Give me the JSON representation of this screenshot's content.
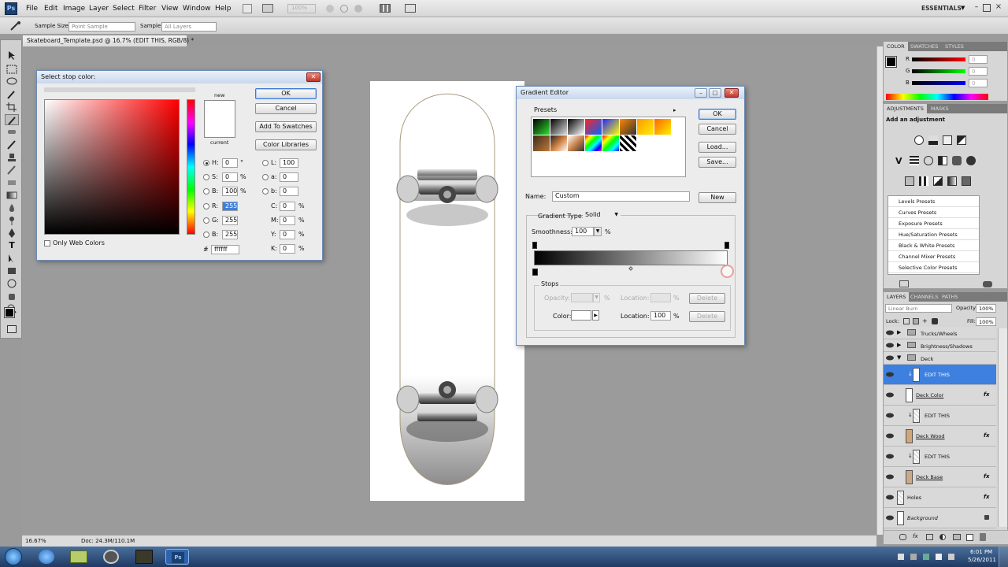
{
  "app": {
    "logo": "Ps",
    "menu": [
      "File",
      "Edit",
      "Image",
      "Layer",
      "Select",
      "Filter",
      "View",
      "Window",
      "Help"
    ],
    "zoom_display": "100%",
    "workspace": "ESSENTIALS"
  },
  "options_bar": {
    "sample_size_label": "Sample Size:",
    "sample_size_value": "Point Sample",
    "sample_label": "Sample:",
    "sample_value": "All Layers"
  },
  "document": {
    "tab_title": "Skateboard_Template.psd @ 16.7% (EDIT THIS, RGB/8) *",
    "status_zoom": "16.67%",
    "status_doc": "Doc: 24.3M/110.1M"
  },
  "color_picker": {
    "title": "Select stop color:",
    "ok": "OK",
    "cancel": "Cancel",
    "add_to_swatches": "Add To Swatches",
    "color_libraries": "Color Libraries",
    "new_label": "new",
    "current_label": "current",
    "only_web_colors": "Only Web Colors",
    "fields": {
      "H": "0",
      "H_unit": "°",
      "S": "0",
      "S_unit": "%",
      "B": "100",
      "B_unit": "%",
      "R": "255",
      "G": "255",
      "Bv": "255",
      "L": "100",
      "a": "0",
      "b": "0",
      "C": "0",
      "M": "0",
      "Y": "0",
      "K": "0",
      "hex": "ffffff"
    }
  },
  "gradient_editor": {
    "title": "Gradient Editor",
    "presets_label": "Presets",
    "ok": "OK",
    "cancel": "Cancel",
    "load": "Load...",
    "save": "Save...",
    "name_label": "Name:",
    "name_value": "Custom",
    "new": "New",
    "gradient_type_label": "Gradient Type:",
    "gradient_type_value": "Solid",
    "smoothness_label": "Smoothness:",
    "smoothness_value": "100",
    "percent": "%",
    "stops_label": "Stops",
    "opacity_label": "Opacity:",
    "location_label": "Location:",
    "delete": "Delete",
    "color_label": "Color:",
    "color_location_value": "100"
  },
  "color_panel": {
    "tabs": [
      "COLOR",
      "SWATCHES",
      "STYLES"
    ],
    "r_label": "R",
    "r_value": "0",
    "g_label": "G",
    "g_value": "0",
    "b_label": "B",
    "b_value": "0"
  },
  "adjustments_panel": {
    "tabs": [
      "ADJUSTMENTS",
      "MASKS"
    ],
    "heading": "Add an adjustment",
    "presets": [
      "Levels Presets",
      "Curves Presets",
      "Exposure Presets",
      "Hue/Saturation Presets",
      "Black & White Presets",
      "Channel Mixer Presets",
      "Selective Color Presets"
    ]
  },
  "layers_panel": {
    "tabs": [
      "LAYERS",
      "CHANNELS",
      "PATHS"
    ],
    "blend_mode": "Linear Burn",
    "opacity_label": "Opacity:",
    "opacity_value": "100%",
    "lock_label": "Lock:",
    "fill_label": "Fill:",
    "fill_value": "100%",
    "layers": [
      {
        "name": "Trucks/Wheels",
        "kind": "group"
      },
      {
        "name": "Brightness/Shadows",
        "kind": "group"
      },
      {
        "name": "Deck",
        "kind": "group-open"
      },
      {
        "name": "EDIT THIS",
        "kind": "selected"
      },
      {
        "name": "Deck Color",
        "kind": "layer-fx"
      },
      {
        "name": "EDIT THIS",
        "kind": "clip"
      },
      {
        "name": "Deck Wood",
        "kind": "layer-fx"
      },
      {
        "name": "EDIT THIS",
        "kind": "clip"
      },
      {
        "name": "Deck Base",
        "kind": "layer-fx"
      },
      {
        "name": "Holes",
        "kind": "layer-fx"
      },
      {
        "name": "Background",
        "kind": "background"
      }
    ],
    "fx": "fx"
  },
  "taskbar": {
    "time": "6:01 PM",
    "date": "5/26/2011",
    "ps_label": "Ps"
  },
  "colors": {
    "accent": "#3b7ad8",
    "selected_layer": "#3d80df",
    "ps_blue": "#1b3f6f"
  }
}
